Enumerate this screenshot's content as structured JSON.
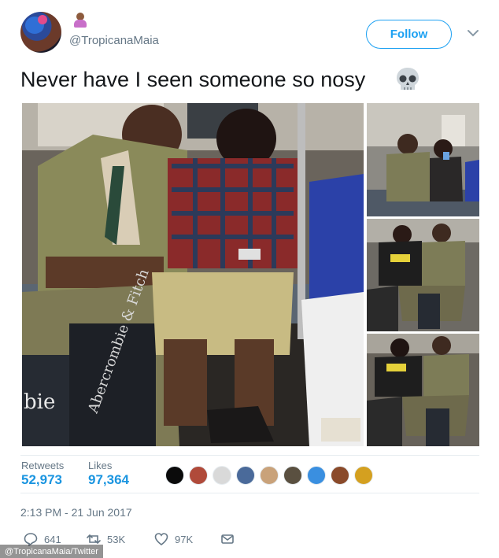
{
  "header": {
    "handle": "@TropicanaMaia",
    "follow_label": "Follow",
    "name_emoji": "woman-facepalming-emoji",
    "avatar_icon": "avatar"
  },
  "tweet": {
    "text": "Never have I seen someone so nosy",
    "emoji": "skull-emoji"
  },
  "stats": {
    "retweets_label": "Retweets",
    "retweets_value": "52,973",
    "likes_label": "Likes",
    "likes_value": "97,364"
  },
  "likers": [
    "#0b0b0b",
    "#b04a3a",
    "#d9d9d9",
    "#4a6a9a",
    "#c9a27a",
    "#5a5040",
    "#3a8fe0",
    "#8a4a2a",
    "#d4a020"
  ],
  "timestamp": "2:13 PM - 21 Jun 2017",
  "actions": {
    "reply_count": "641",
    "retweet_count": "53K",
    "like_count": "97K"
  },
  "photo_text": {
    "bag_brand_main": "Abercrombie & Fitch",
    "bag_text_short": "bie"
  },
  "credit": "@TropicanaMaia/Twitter",
  "colors": {
    "accent": "#1da1f2",
    "link_value": "#1b95e0",
    "muted": "#657786"
  }
}
